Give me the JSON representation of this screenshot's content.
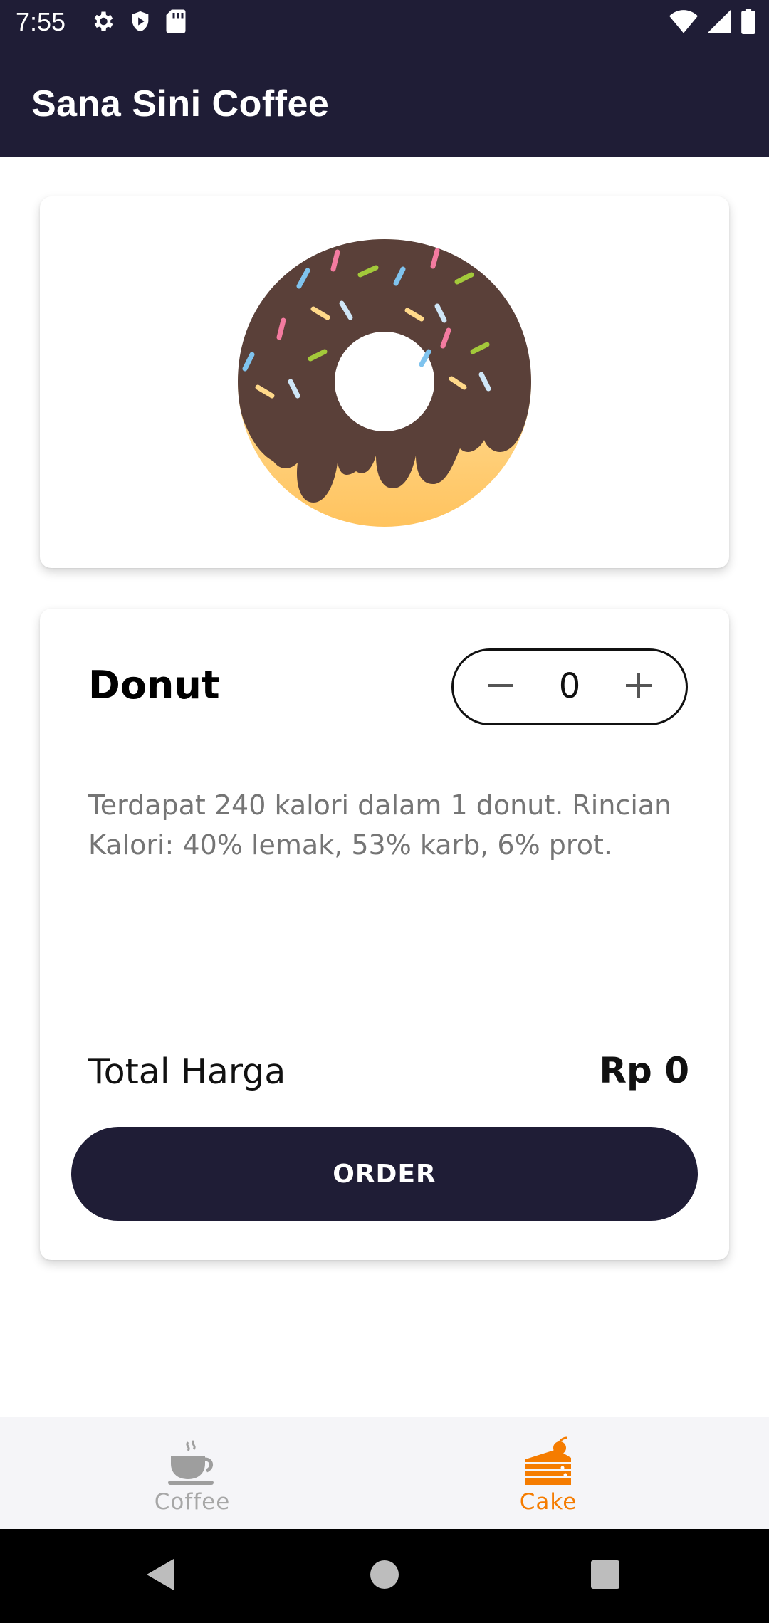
{
  "status_bar": {
    "time": "7:55",
    "left_icons": [
      "gear-icon",
      "shield-play-icon",
      "sd-card-icon"
    ],
    "right_icons": [
      "wifi-icon",
      "cell-signal-icon",
      "battery-icon"
    ]
  },
  "app_bar": {
    "title": "Sana Sini Coffee"
  },
  "product": {
    "name": "Donut",
    "image_icon": "donut-icon",
    "quantity": "0",
    "description": "Terdapat 240 kalori dalam 1 donut. Rincian Kalori: 40% lemak, 53% karb, 6% prot.",
    "total_label": "Total Harga",
    "total_value": "Rp 0",
    "order_label": "ORDER"
  },
  "bottom_nav": {
    "items": [
      {
        "label": "Coffee",
        "icon": "coffee-cup-icon",
        "active": false
      },
      {
        "label": "Cake",
        "icon": "cake-icon",
        "active": true
      }
    ]
  },
  "colors": {
    "primary": "#1f1d36",
    "accent": "#f57c00",
    "inactive": "#a7a7a7",
    "text_secondary": "#757575"
  }
}
